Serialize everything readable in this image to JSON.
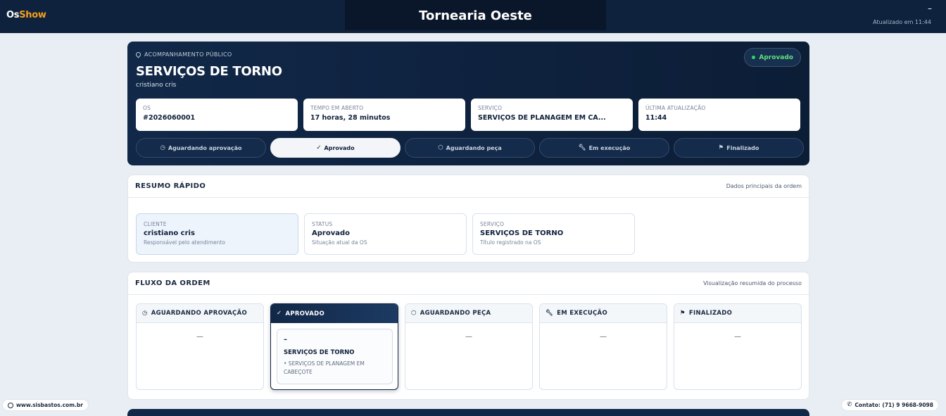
{
  "header": {
    "brand_part1": "Os",
    "brand_part2": "Show",
    "company": "Tornearia Oeste",
    "dash": "–",
    "updated": "Atualizado em 11:44"
  },
  "hero": {
    "kicker": "ACOMPANHAMENTO PÚBLICO",
    "title": "SERVIÇOS DE TORNO",
    "subtitle": "cristiano cris",
    "status": "Aprovado",
    "cards": [
      {
        "label": "OS",
        "value": "#2026060001"
      },
      {
        "label": "TEMPO EM ABERTO",
        "value": "17 horas, 28 minutos"
      },
      {
        "label": "SERVIÇO",
        "value": "SERVIÇOS DE PLANAGEM EM CA..."
      },
      {
        "label": "ÚLTIMA ATUALIZAÇÃO",
        "value": "11:44"
      }
    ],
    "steps": [
      {
        "label": "Aguardando aprovação",
        "icon": "clock-icon"
      },
      {
        "label": "Aprovado",
        "icon": "check-icon"
      },
      {
        "label": "Aguardando peça",
        "icon": "box-icon"
      },
      {
        "label": "Em execução",
        "icon": "wrench-icon"
      },
      {
        "label": "Finalizado",
        "icon": "flag-icon"
      }
    ]
  },
  "resume": {
    "title": "RESUMO RÁPIDO",
    "note": "Dados principais da ordem",
    "cards": [
      {
        "label": "CLIENTE",
        "value": "cristiano cris",
        "hint": "Responsável pelo atendimento"
      },
      {
        "label": "STATUS",
        "value": "Aprovado",
        "hint": "Situação atual da OS"
      },
      {
        "label": "SERVIÇO",
        "value": "SERVIÇOS DE TORNO",
        "hint": "Título registrado na OS"
      }
    ]
  },
  "flow": {
    "title": "FLUXO DA ORDEM",
    "note": "Visualização resumida do processo",
    "columns": [
      {
        "label": "AGUARDANDO APROVAÇÃO",
        "empty": "—"
      },
      {
        "label": "APROVADO"
      },
      {
        "label": "AGUARDANDO PEÇA",
        "empty": "—"
      },
      {
        "label": "EM EXECUÇÃO",
        "empty": "—"
      },
      {
        "label": "FINALIZADO",
        "empty": "—"
      }
    ],
    "task": {
      "dash": "–",
      "title": "SERVIÇOS DE TORNO",
      "desc": "• SERVIÇOS DE PLANAGEM EM CABEÇOTE"
    }
  },
  "footer": {
    "site": "www.sisbastos.com.br",
    "contact": "Contato: (71) 9 9668-9098"
  },
  "colors": {
    "navy": "#0f223d",
    "accent": "#f5a01c",
    "success": "#5ee07f"
  }
}
